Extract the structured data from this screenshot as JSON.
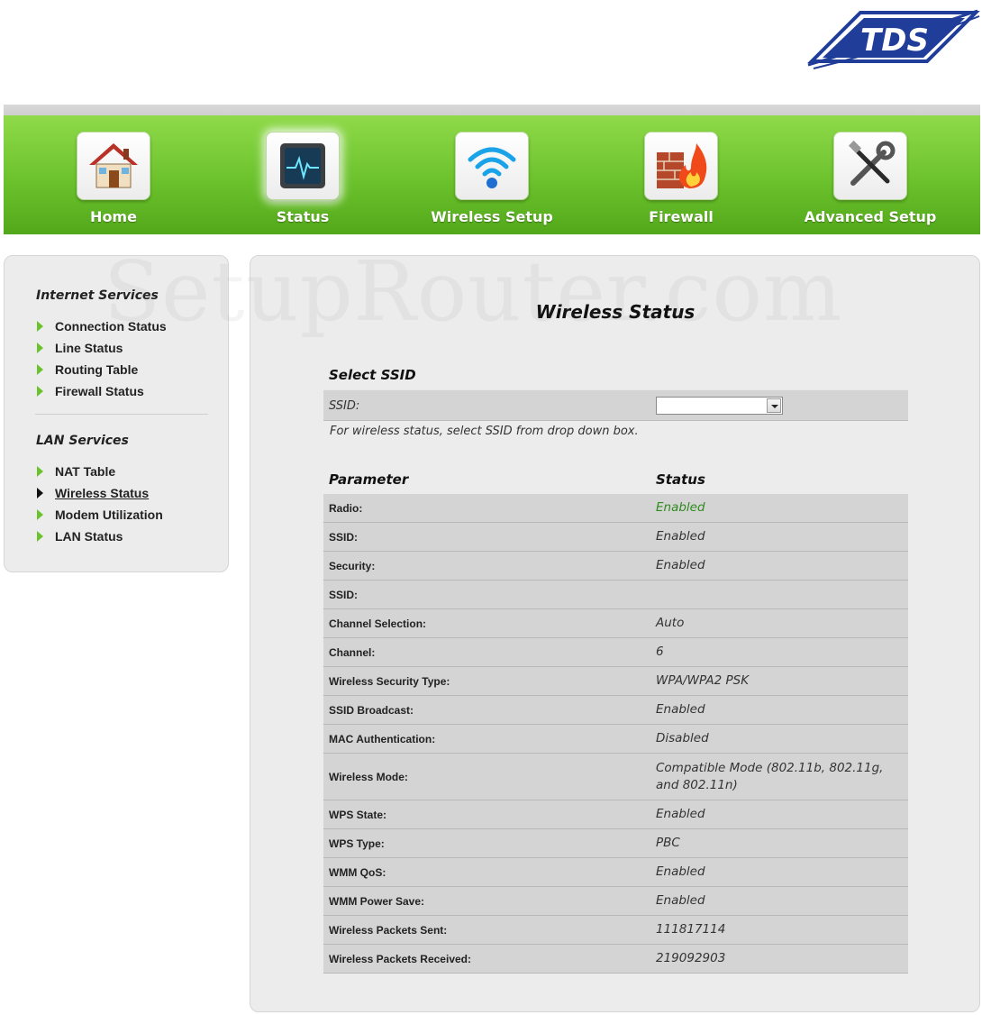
{
  "brand": {
    "logo_text": "TDS",
    "color_primary": "#1f3d99",
    "color_nav": "#6cc22c"
  },
  "nav": {
    "items": [
      {
        "label": "Home",
        "icon": "home-icon"
      },
      {
        "label": "Status",
        "icon": "status-monitor-icon"
      },
      {
        "label": "Wireless Setup",
        "icon": "wifi-icon"
      },
      {
        "label": "Firewall",
        "icon": "firewall-icon"
      },
      {
        "label": "Advanced Setup",
        "icon": "tools-icon"
      }
    ],
    "active": "Status"
  },
  "sidebar": {
    "internet": {
      "heading": "Internet Services",
      "items": [
        "Connection Status",
        "Line Status",
        "Routing Table",
        "Firewall Status"
      ]
    },
    "lan": {
      "heading": "LAN Services",
      "items": [
        "NAT Table",
        "Wireless Status",
        "Modem Utilization",
        "LAN Status"
      ]
    },
    "current": "Wireless Status"
  },
  "watermark": "SetupRouter.com",
  "main": {
    "title": "Wireless Status",
    "select_ssid": {
      "heading": "Select SSID",
      "label": "SSID:",
      "selected_value": "",
      "hint": "For wireless status, select SSID from drop down box."
    },
    "table": {
      "col_param": "Parameter",
      "col_status": "Status",
      "rows": [
        {
          "param": "Radio:",
          "value": "Enabled"
        },
        {
          "param": "SSID:",
          "value": "Enabled"
        },
        {
          "param": "Security:",
          "value": "Enabled"
        },
        {
          "param": "SSID:",
          "value": ""
        },
        {
          "param": "Channel Selection:",
          "value": "Auto"
        },
        {
          "param": "Channel:",
          "value": "6"
        },
        {
          "param": "Wireless Security Type:",
          "value": "WPA/WPA2 PSK"
        },
        {
          "param": "SSID Broadcast:",
          "value": "Enabled"
        },
        {
          "param": "MAC Authentication:",
          "value": "Disabled"
        },
        {
          "param": "Wireless Mode:",
          "value": "Compatible Mode (802.11b, 802.11g, and 802.11n)"
        },
        {
          "param": "WPS State:",
          "value": "Enabled"
        },
        {
          "param": "WPS Type:",
          "value": "PBC"
        },
        {
          "param": "WMM QoS:",
          "value": "Enabled"
        },
        {
          "param": "WMM Power Save:",
          "value": "Enabled"
        },
        {
          "param": "Wireless Packets Sent:",
          "value": "111817114"
        },
        {
          "param": "Wireless Packets Received:",
          "value": "219092903"
        }
      ]
    }
  }
}
